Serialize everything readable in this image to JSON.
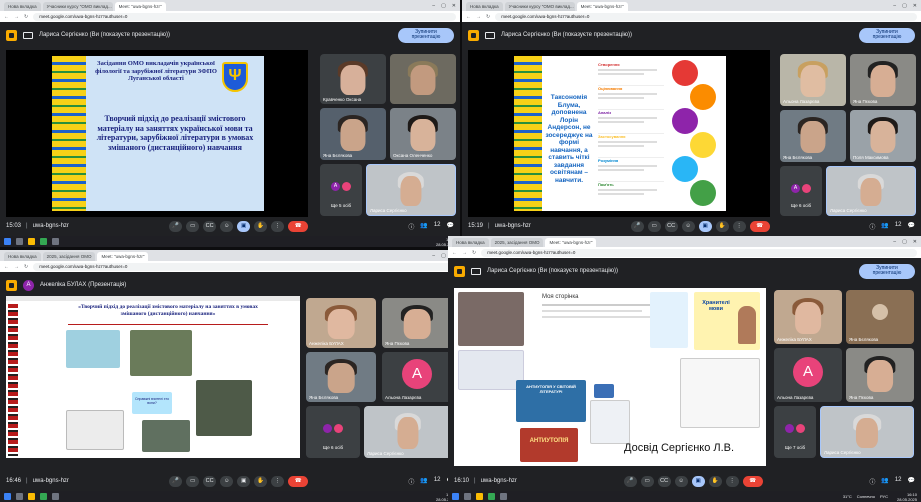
{
  "browser": {
    "tabs": [
      "Нова вкладка",
      "Учасники курсу \"ОМО виклад...",
      "Meet: \"uwa-bgns-hzr\""
    ],
    "tabs_q2": [
      "Нова вкладка",
      "2025, засідання ОМО",
      "Meet: \"uwa-bgns-hzr\""
    ],
    "url": "meet.google.com/uwa-bgns-hzr?authuser=0"
  },
  "meeting": {
    "code": "uwa-bgns-hzr",
    "stop_label": "Зупинити презентацію"
  },
  "panels": [
    {
      "presenter": "Лариса Сергієнко (Ви (показуєте презентацію))",
      "time": "15:03",
      "slide": {
        "heading": "Засідання ОМО викладачів української філології та зарубіжної літератури ЗФПО Луганської області",
        "title": "Творчий підхід до реалізації змістового матеріалу на заняттях української мови та літератури, зарубіжної літератури в умовах змішаного (дистанційного) навчання"
      },
      "tiles": [
        {
          "name": "Кравченко Оксана"
        },
        {
          "name": "Яна Бєлякова"
        },
        {
          "name": "Оксана Оленченко"
        },
        {
          "name": "Ще 5 осіб"
        },
        {
          "name": "Лариса Сергієнко"
        }
      ]
    },
    {
      "presenter": "Лариса Сергієнко (Ви (показуєте презентацію))",
      "time": "15:19",
      "slide": {
        "text": "Таксономія Блума, доповнена Лорін Андерсон, не зосереджує на формі навчання, а ставить чіткі завдання освітянам – навчити.",
        "levels": [
          "Створення",
          "Оцінювання",
          "Аналіз",
          "Застосування",
          "Розуміння",
          "Пам'ять"
        ]
      },
      "tiles": [
        {
          "name": "Альона Лазарєва"
        },
        {
          "name": "Яна Пєкова"
        },
        {
          "name": "Яна Бєлякова"
        },
        {
          "name": "Поля Максимова"
        },
        {
          "name": "Ще 6 осіб"
        },
        {
          "name": "Лариса Сергієнко"
        }
      ]
    },
    {
      "presenter": "Анжеліка БУЛАХ (Презентація)",
      "time": "16:46",
      "slide": {
        "title": "«Творчий підхід до реалізації змістового матеріалу на заняттях в умовах змішаного (дистанційного) навчання»",
        "question": "Справжні вчителі хто вони?"
      },
      "tiles": [
        {
          "name": "Анжеліка БУЛАХ"
        },
        {
          "name": "Яна Пєкова"
        },
        {
          "name": "Яна Бєлякова"
        },
        {
          "name": "Альона Лазарєва"
        },
        {
          "name": "Ще 6 осіб"
        },
        {
          "name": "Лариса Сергієнко"
        }
      ]
    },
    {
      "presenter": "Лариса Сергієнко (Ви (показуєте презентацію))",
      "time": "16:10",
      "slide": {
        "heading": "Моя сторінка",
        "book": "Хранителі мови",
        "card1": "АНТИУТОПІЯ У СВІТОВІЙ ЛІТЕРАТУРІ",
        "card2": "АНТИУТОПІЯ",
        "caption": "Досвід Сергієнко Л.В."
      },
      "tiles": [
        {
          "name": "Анжеліка БУЛАХ"
        },
        {
          "name": "Яна Бєлякова"
        },
        {
          "name": "Альона Лазарєва"
        },
        {
          "name": "Яна Пєкова"
        },
        {
          "name": "Ще 7 осіб"
        },
        {
          "name": "Лариса Сергієнко"
        }
      ]
    }
  ],
  "avatar_letter": "A",
  "participant_count": "12",
  "taskbar": {
    "temp": "31°C",
    "weather": "Солнечно",
    "lang": "РУС",
    "q0": {
      "time": "15:03",
      "date": "28.05.2025"
    },
    "q1": {
      "time": "15:19",
      "date": "28.05.2025"
    },
    "q2": {
      "time": "16:46",
      "date": "28.05.2025"
    },
    "q3": {
      "time": "16:10",
      "date": "28.05.2025"
    }
  }
}
